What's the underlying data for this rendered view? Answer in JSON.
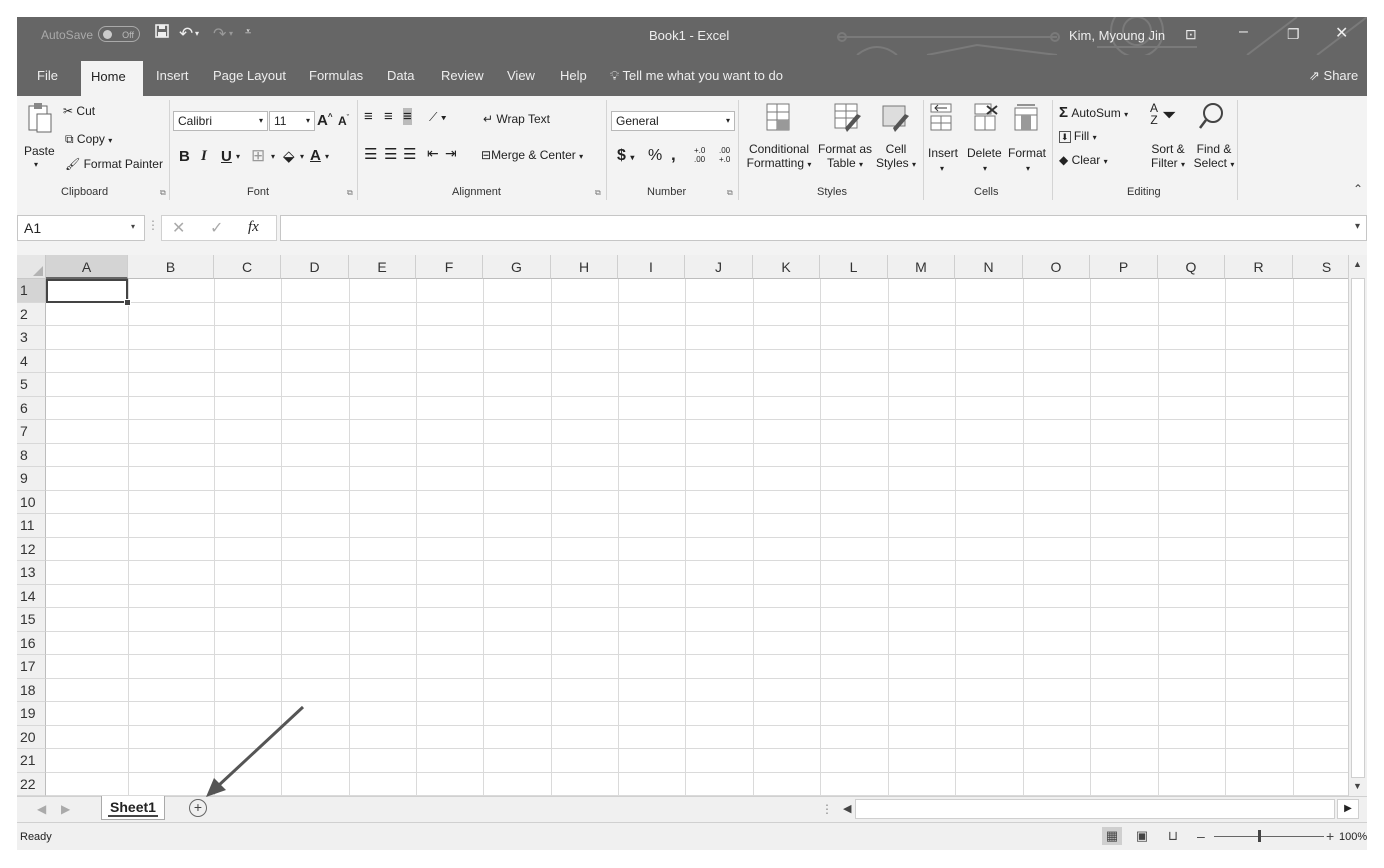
{
  "titlebar": {
    "autosave_label": "AutoSave",
    "autosave_state": "Off",
    "title": "Book1 - Excel",
    "user": "Kim, Myoung Jin",
    "icons": [
      "save-icon",
      "undo-icon",
      "redo-icon",
      "customize-icon",
      "ribbon-display-icon",
      "minimize-icon",
      "restore-icon",
      "close-icon"
    ]
  },
  "tabs": [
    "File",
    "Home",
    "Insert",
    "Page Layout",
    "Formulas",
    "Data",
    "Review",
    "View",
    "Help"
  ],
  "tell_me": "Tell me what you want to do",
  "share": "Share",
  "ribbon": {
    "clipboard": {
      "paste": "Paste",
      "cut": "Cut",
      "copy": "Copy",
      "format_painter": "Format Painter",
      "label": "Clipboard"
    },
    "font": {
      "name": "Calibri",
      "size": "11",
      "bold": "B",
      "italic": "I",
      "underline": "U",
      "label": "Font"
    },
    "alignment": {
      "wrap": "Wrap Text",
      "merge": "Merge & Center",
      "label": "Alignment"
    },
    "number": {
      "format": "General",
      "currency": "$",
      "percent": "%",
      "comma": ",",
      "inc_dec": "+.0 .00",
      "dec_dec": ".00 +.0",
      "label": "Number"
    },
    "styles": {
      "cond_line1": "Conditional",
      "cond_line2": "Formatting",
      "table_line1": "Format as",
      "table_line2": "Table",
      "cell_line1": "Cell",
      "cell_line2": "Styles",
      "label": "Styles"
    },
    "cells": {
      "insert": "Insert",
      "delete": "Delete",
      "format": "Format",
      "label": "Cells"
    },
    "editing": {
      "autosum": "AutoSum",
      "fill": "Fill",
      "clear": "Clear",
      "sort_line1": "Sort &",
      "sort_line2": "Filter",
      "find_line1": "Find &",
      "find_line2": "Select",
      "label": "Editing"
    }
  },
  "formula_bar": {
    "name_box": "A1",
    "fx": "fx",
    "value": ""
  },
  "columns": [
    "A",
    "B",
    "C",
    "D",
    "E",
    "F",
    "G",
    "H",
    "I",
    "J",
    "K",
    "L",
    "M",
    "N",
    "O",
    "P",
    "Q",
    "R",
    "S"
  ],
  "rows": [
    "1",
    "2",
    "3",
    "4",
    "5",
    "6",
    "7",
    "8",
    "9",
    "10",
    "11",
    "12",
    "13",
    "14",
    "15",
    "16",
    "17",
    "18",
    "19",
    "20",
    "21",
    "22"
  ],
  "selected_cell": "A1",
  "sheets": [
    "Sheet1"
  ],
  "status": {
    "ready": "Ready",
    "zoom": "100%"
  },
  "colors": {
    "titlebar_bg": "#666666",
    "ribbon_bg": "#f3f3f3",
    "gridline": "#dadada",
    "header_bg": "#f0f0f0"
  }
}
